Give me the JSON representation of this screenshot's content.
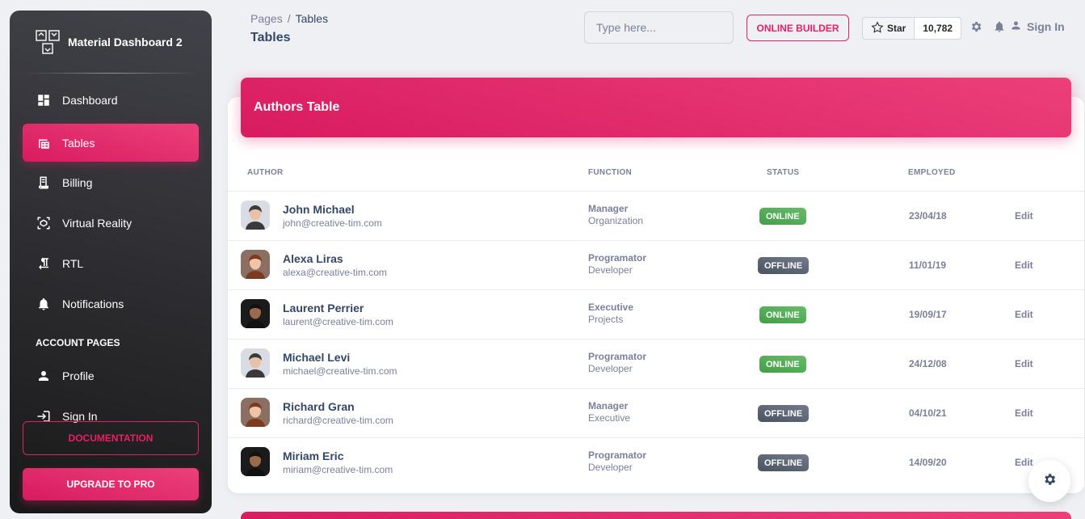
{
  "brand": {
    "name": "Material Dashboard 2",
    "logo_icon": "dashboard-logo-icon"
  },
  "sidebar": {
    "items": [
      {
        "label": "Dashboard",
        "icon": "dashboard-icon",
        "active": false
      },
      {
        "label": "Tables",
        "icon": "table-icon",
        "active": true
      },
      {
        "label": "Billing",
        "icon": "receipt-icon",
        "active": false
      },
      {
        "label": "Virtual Reality",
        "icon": "view-in-ar-icon",
        "active": false
      },
      {
        "label": "RTL",
        "icon": "format-textdirection-icon",
        "active": false
      },
      {
        "label": "Notifications",
        "icon": "bell-icon",
        "active": false
      }
    ],
    "section_label": "ACCOUNT PAGES",
    "account_items": [
      {
        "label": "Profile",
        "icon": "person-icon"
      },
      {
        "label": "Sign In",
        "icon": "login-icon"
      }
    ],
    "documentation_label": "DOCUMENTATION",
    "upgrade_label": "UPGRADE TO PRO"
  },
  "header": {
    "breadcrumb_root": "Pages",
    "breadcrumb_sep": "/",
    "breadcrumb_current": "Tables",
    "title": "Tables",
    "search_placeholder": "Type here...",
    "builder_label": "ONLINE BUILDER",
    "star_label": "Star",
    "star_count": "10,782",
    "signin_label": "Sign In"
  },
  "table": {
    "title": "Authors Table",
    "columns": [
      "AUTHOR",
      "FUNCTION",
      "STATUS",
      "EMPLOYED"
    ],
    "edit_label": "Edit",
    "rows": [
      {
        "name": "John Michael",
        "email": "john@creative-tim.com",
        "function": "Manager",
        "department": "Organization",
        "status": "ONLINE",
        "employed": "23/04/18"
      },
      {
        "name": "Alexa Liras",
        "email": "alexa@creative-tim.com",
        "function": "Programator",
        "department": "Developer",
        "status": "OFFLINE",
        "employed": "11/01/19"
      },
      {
        "name": "Laurent Perrier",
        "email": "laurent@creative-tim.com",
        "function": "Executive",
        "department": "Projects",
        "status": "ONLINE",
        "employed": "19/09/17"
      },
      {
        "name": "Michael Levi",
        "email": "michael@creative-tim.com",
        "function": "Programator",
        "department": "Developer",
        "status": "ONLINE",
        "employed": "24/12/08"
      },
      {
        "name": "Richard Gran",
        "email": "richard@creative-tim.com",
        "function": "Manager",
        "department": "Executive",
        "status": "OFFLINE",
        "employed": "04/10/21"
      },
      {
        "name": "Miriam Eric",
        "email": "miriam@creative-tim.com",
        "function": "Programator",
        "department": "Developer",
        "status": "OFFLINE",
        "employed": "14/09/20"
      }
    ]
  },
  "colors": {
    "primary": "#e91e63",
    "success": "#4caf50",
    "secondary": "#7b809a",
    "dark": "#344767"
  }
}
